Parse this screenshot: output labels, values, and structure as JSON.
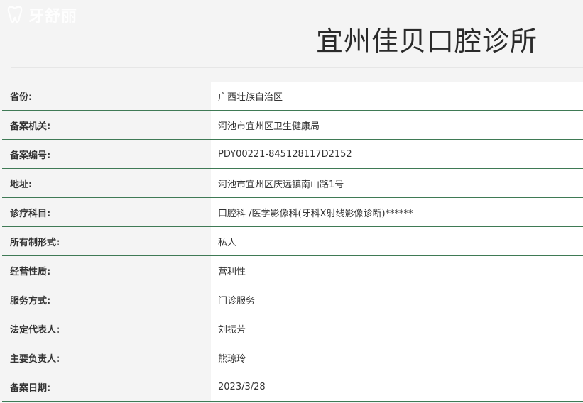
{
  "watermark": {
    "text": "牙舒丽",
    "icon": "tooth-logo-icon"
  },
  "page": {
    "title": "宜州佳贝口腔诊所"
  },
  "records": [
    {
      "label": "省份:",
      "value": "广西壮族自治区"
    },
    {
      "label": "备案机关:",
      "value": "河池市宜州区卫生健康局"
    },
    {
      "label": "备案编号:",
      "value": "PDY00221-845128117D2152"
    },
    {
      "label": "地址:",
      "value": "河池市宜州区庆远镇南山路1号"
    },
    {
      "label": "诊疗科目:",
      "value": "口腔科 /医学影像科(牙科X射线影像诊断)******"
    },
    {
      "label": "所有制形式:",
      "value": "私人"
    },
    {
      "label": "经营性质:",
      "value": "营利性"
    },
    {
      "label": "服务方式:",
      "value": "门诊服务"
    },
    {
      "label": "法定代表人:",
      "value": "刘振芳"
    },
    {
      "label": "主要负责人:",
      "value": "熊琼玲"
    },
    {
      "label": "备案日期:",
      "value": "2023/3/28"
    }
  ],
  "colors": {
    "row_divider": "#3f7a55",
    "label_bg": "#f4f4f4",
    "value_bg": "#ffffff"
  }
}
